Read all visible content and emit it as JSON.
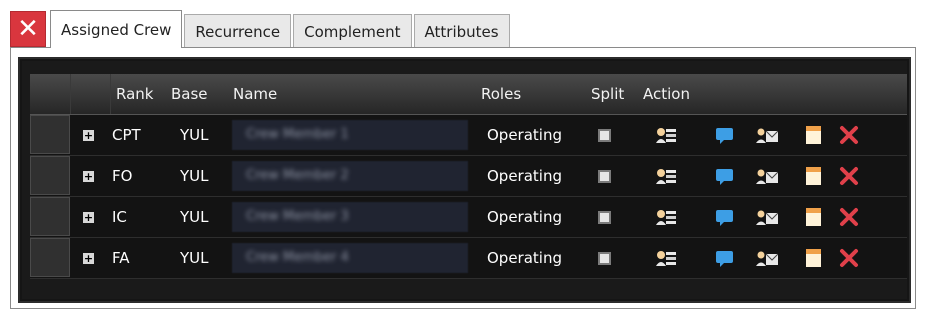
{
  "tabs": [
    {
      "label": "Assigned Crew",
      "active": true
    },
    {
      "label": "Recurrence",
      "active": false
    },
    {
      "label": "Complement",
      "active": false
    },
    {
      "label": "Attributes",
      "active": false
    }
  ],
  "close_icon": "close-x-icon",
  "columns": {
    "rank": "Rank",
    "base": "Base",
    "name": "Name",
    "roles": "Roles",
    "split": "Split",
    "action": "Action"
  },
  "rows": [
    {
      "rank": "CPT",
      "base": "YUL",
      "name": "Crew Member 1",
      "role": "Operating"
    },
    {
      "rank": "FO",
      "base": "YUL",
      "name": "Crew Member 2",
      "role": "Operating"
    },
    {
      "rank": "IC",
      "base": "YUL",
      "name": "Crew Member 3",
      "role": "Operating"
    },
    {
      "rank": "FA",
      "base": "YUL",
      "name": "Crew Member 4",
      "role": "Operating"
    }
  ],
  "action_icons": [
    "crew-card-icon",
    "message-icon",
    "mail-crew-icon",
    "notes-icon",
    "remove-icon"
  ],
  "colors": {
    "close_red": "#d9363e",
    "grid_bg": "#131313",
    "message_blue": "#3d9ee5",
    "notes_orange": "#f0a14a",
    "remove_red": "#e0404a"
  }
}
